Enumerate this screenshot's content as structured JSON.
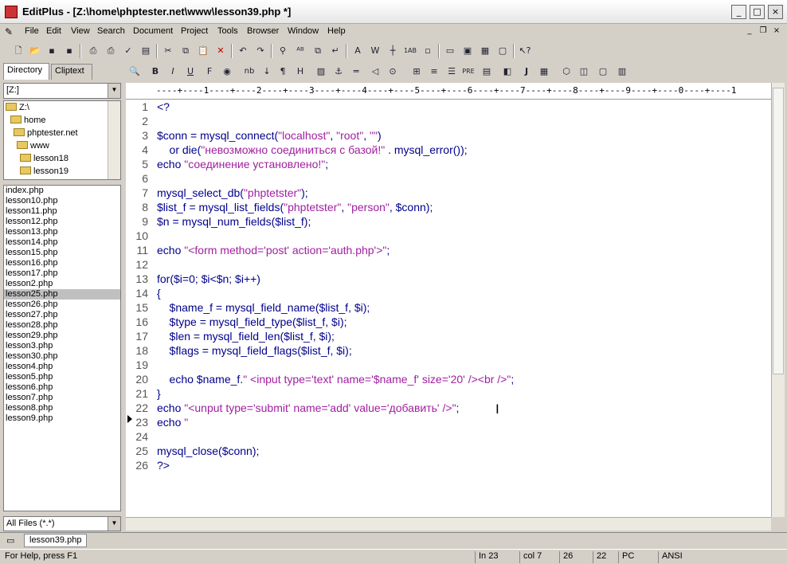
{
  "title": "EditPlus - [Z:\\home\\phptester.net\\www\\lesson39.php *]",
  "menu": [
    "File",
    "Edit",
    "View",
    "Search",
    "Document",
    "Project",
    "Tools",
    "Browser",
    "Window",
    "Help"
  ],
  "panel": {
    "tabs": [
      "Directory",
      "Cliptext"
    ],
    "drive": "[Z:]",
    "tree": [
      "Z:\\",
      "home",
      "phptester.net",
      "www",
      "lesson18",
      "lesson19"
    ],
    "files": [
      "index.php",
      "lesson10.php",
      "lesson11.php",
      "lesson12.php",
      "lesson13.php",
      "lesson14.php",
      "lesson15.php",
      "lesson16.php",
      "lesson17.php",
      "lesson2.php",
      "lesson25.php",
      "lesson26.php",
      "lesson27.php",
      "lesson28.php",
      "lesson29.php",
      "lesson3.php",
      "lesson30.php",
      "lesson4.php",
      "lesson5.php",
      "lesson6.php",
      "lesson7.php",
      "lesson8.php",
      "lesson9.php"
    ],
    "selected_file": "lesson25.php",
    "filter": "All Files (*.*)"
  },
  "ruler": "----+----1----+----2----+----3----+----4----+----5----+----6----+----7----+----8----+----9----+----0----+----1",
  "code": [
    "<?",
    "",
    "$conn = mysql_connect(\"localhost\", \"root\", \"\")",
    "    or die(\"невозможно соединиться с базой!\" . mysql_error());",
    "echo \"соединение установлено!\";",
    "",
    "mysql_select_db(\"phptetster\");",
    "$list_f = mysql_list_fields(\"phptetster\", \"person\", $conn);",
    "$n = mysql_num_fields($list_f);",
    "",
    "echo \"<form method='post' action='auth.php'>\";",
    "",
    "for($i=0; $i<$n; $i++)",
    "{",
    "    $name_f = mysql_field_name($list_f, $i);",
    "    $type = mysql_field_type($list_f, $i);",
    "    $len = mysql_field_len($list_f, $i);",
    "    $flags = mysql_field_flags($list_f, $i);",
    "",
    "    echo $name_f.\" <input type='text' name='$name_f' size='20' /><br />\";",
    "}",
    "echo \"<unput type='submit' name='add' value='добавить' />\";",
    "echo \"",
    "",
    "mysql_close($conn);",
    "?>"
  ],
  "doc_tab": "lesson39.php",
  "status": {
    "help": "For Help, press F1",
    "line": "In 23",
    "col": "col 7",
    "total": "26",
    "num": "22",
    "mode": "PC",
    "encoding": "ANSI"
  },
  "colors": {
    "keyword": "#00008b",
    "string": "#a020a0",
    "chrome": "#d4d0c8"
  }
}
